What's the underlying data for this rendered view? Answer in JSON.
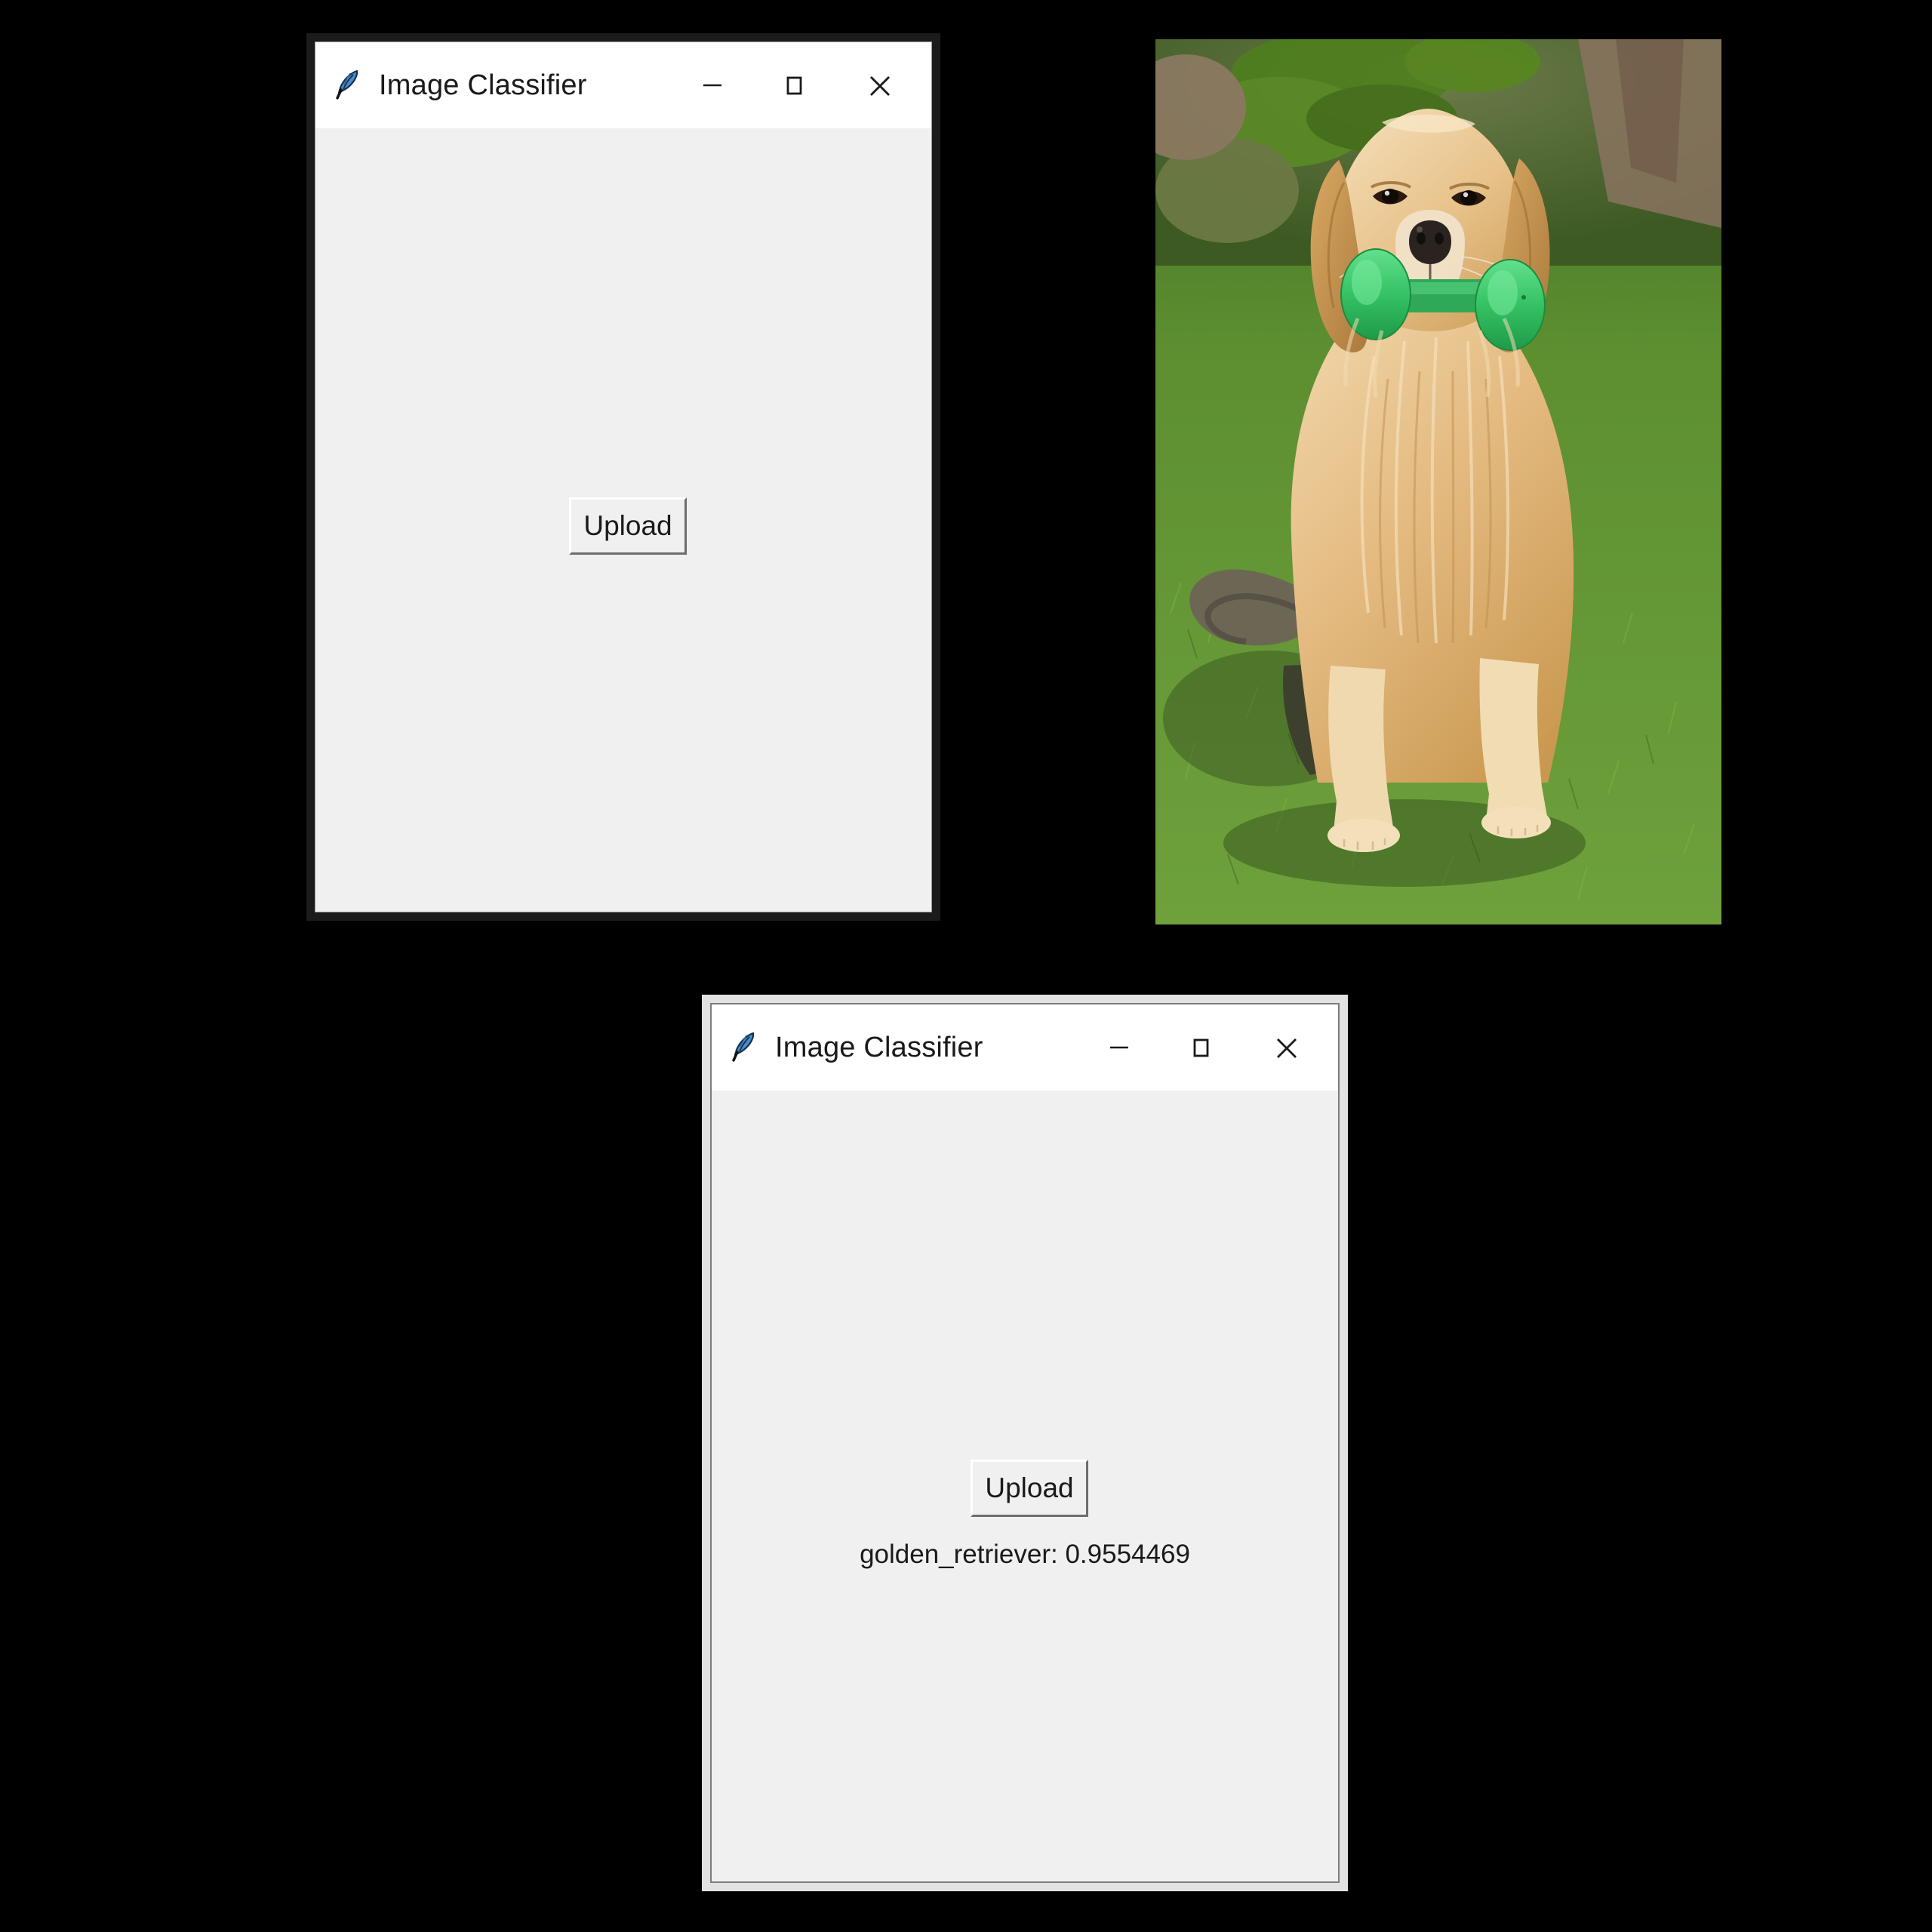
{
  "background_color": "#000000",
  "windows": [
    {
      "id": "window-before",
      "state": "inactive",
      "title": "Image Classifier",
      "icon": "tk-feather-icon",
      "controls": {
        "minimize": "minimize-icon",
        "maximize": "maximize-icon",
        "close": "close-icon"
      },
      "upload_button_label": "Upload",
      "result_text": "",
      "frame_color": "#1b1b1b",
      "client_color": "#f0f0f0",
      "titlebar_color": "#ffffff"
    },
    {
      "id": "window-after",
      "state": "active",
      "title": "Image Classifier",
      "icon": "tk-feather-icon",
      "controls": {
        "minimize": "minimize-icon",
        "maximize": "maximize-icon",
        "close": "close-icon"
      },
      "upload_button_label": "Upload",
      "result_text": "golden_retriever: 0.9554469",
      "prediction": {
        "label": "golden_retriever",
        "confidence": "0.9554469"
      },
      "frame_color": "#e2e2e2",
      "client_color": "#f0f0f0",
      "titlebar_color": "#ffffff"
    }
  ],
  "photo": {
    "name": "golden-retriever-photo",
    "subject": "golden retriever dog sitting on grass holding a green dumbbell toy",
    "colors": {
      "grass": "#5f9133",
      "grass_dark": "#3d6322",
      "fur": "#e6bb80",
      "fur_light": "#f4dcb4",
      "fur_dark": "#c08f4f",
      "toy": "#3ecb6e",
      "nose": "#2b2320",
      "tag": "#3aa8dd",
      "foliage": "#4d7a20",
      "bark": "#8a7360"
    }
  }
}
